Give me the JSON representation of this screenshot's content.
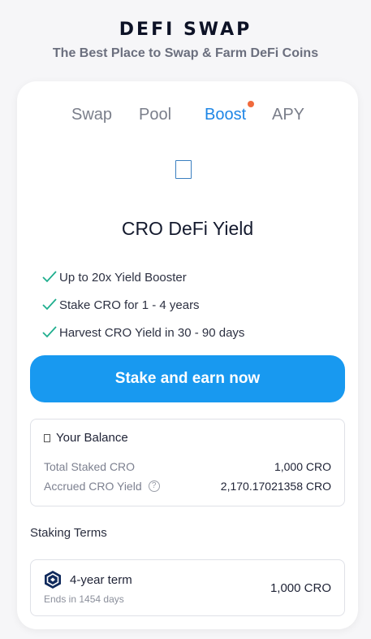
{
  "header": {
    "title": "DEFI SWAP",
    "subtitle": "The Best Place to Swap & Farm DeFi Coins"
  },
  "tabs": [
    {
      "label": "Swap",
      "active": false
    },
    {
      "label": "Pool",
      "active": false
    },
    {
      "label": "Boost",
      "active": true,
      "notification": true
    },
    {
      "label": "APY",
      "active": false
    }
  ],
  "boost": {
    "title": "CRO DeFi Yield",
    "features": [
      "Up to 20x Yield Booster",
      "Stake CRO for 1 - 4 years",
      "Harvest CRO Yield in 30 - 90 days"
    ],
    "cta_label": "Stake and earn now"
  },
  "balance": {
    "title": "Your Balance",
    "total_staked_label": "Total Staked CRO",
    "total_staked_value": "1,000 CRO",
    "accrued_label": "Accrued CRO Yield",
    "accrued_value": "2,170.17021358 CRO",
    "help_glyph": "?"
  },
  "staking_terms": {
    "heading": "Staking Terms",
    "items": [
      {
        "name": "4-year term",
        "ends": "Ends in 1454 days",
        "amount": "1,000 CRO"
      }
    ]
  },
  "colors": {
    "accent": "#1e86e6",
    "cta": "#1899f0",
    "check": "#1fae8e",
    "notification": "#f06a3d",
    "cro_logo": "#102a5c"
  }
}
